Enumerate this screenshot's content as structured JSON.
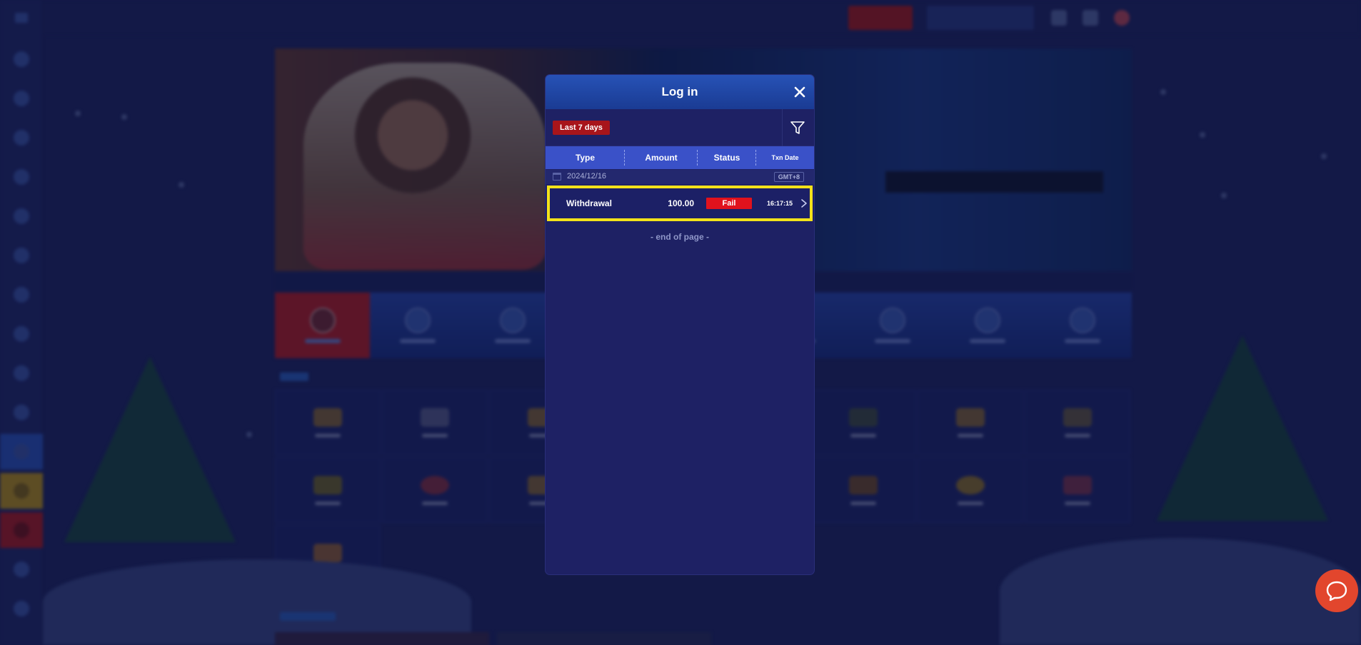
{
  "modal": {
    "title": "Log in",
    "period_badge": "Last 7 days",
    "filter_icon": "filter-funnel-icon",
    "close_icon": "close-x-icon",
    "columns": [
      "Type",
      "Amount",
      "Status",
      "Txn Date"
    ],
    "date_group": {
      "date": "2024/12/16",
      "timezone": "GMT+8"
    },
    "rows": [
      {
        "type": "Withdrawal",
        "amount": "100.00",
        "status": "Fail",
        "time": "16:17:15"
      }
    ],
    "end_text": "- end of page -"
  },
  "colors": {
    "accent": "#3a51c8",
    "header": "#2752b6",
    "badge_red": "#a8151b",
    "fail_red": "#e1121d",
    "highlight": "#f3e21a",
    "chat": "#e2462d"
  },
  "chat": {
    "icon": "chat-bubble-icon"
  }
}
